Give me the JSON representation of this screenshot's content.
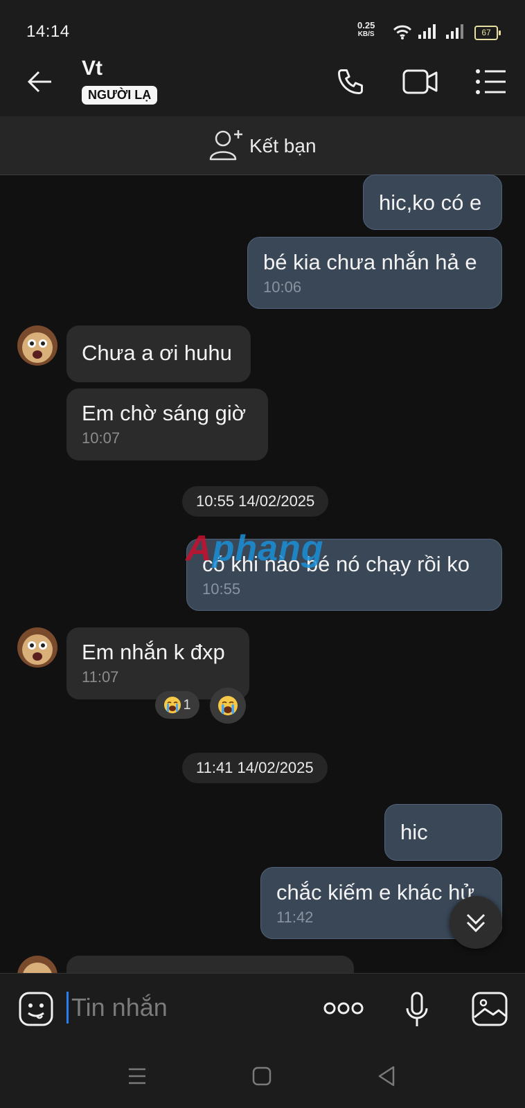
{
  "status_bar": {
    "time": "14:14",
    "net_speed": "0.25",
    "net_unit": "KB/S",
    "battery": "67"
  },
  "header": {
    "contact_name": "Vt",
    "stranger_badge": "NGƯỜI LẠ"
  },
  "friend_bar": {
    "label": "Kết bạn"
  },
  "watermark": {
    "part1": "A",
    "part2": "phang"
  },
  "messages": [
    {
      "dir": "out",
      "text": "hic,ko có e",
      "time": ""
    },
    {
      "dir": "out",
      "text": "bé kia chưa nhắn hả e",
      "time": "10:06"
    },
    {
      "dir": "in",
      "text": "Chưa a ơi huhu",
      "time": ""
    },
    {
      "dir": "in",
      "text": "Em chờ sáng giờ",
      "time": "10:07"
    },
    {
      "dir": "date",
      "text": "10:55 14/02/2025"
    },
    {
      "dir": "out",
      "text": "có khi nào bé nó chạy rồi ko",
      "time": "10:55"
    },
    {
      "dir": "in",
      "text": "Em nhắn k đxp",
      "time": "11:07"
    },
    {
      "dir": "date",
      "text": "11:41 14/02/2025"
    },
    {
      "dir": "out",
      "text": "hic",
      "time": ""
    },
    {
      "dir": "out",
      "text": "chắc kiếm e khác hử",
      "time": "11:42"
    }
  ],
  "reactions": {
    "crying_count": "1"
  },
  "composer": {
    "placeholder": "Tin nhắn"
  },
  "colors": {
    "outgoing_bubble": "#3a4757",
    "incoming_bubble": "#2b2b2b",
    "background": "#111111",
    "cursor_accent": "#2a7ff0"
  }
}
